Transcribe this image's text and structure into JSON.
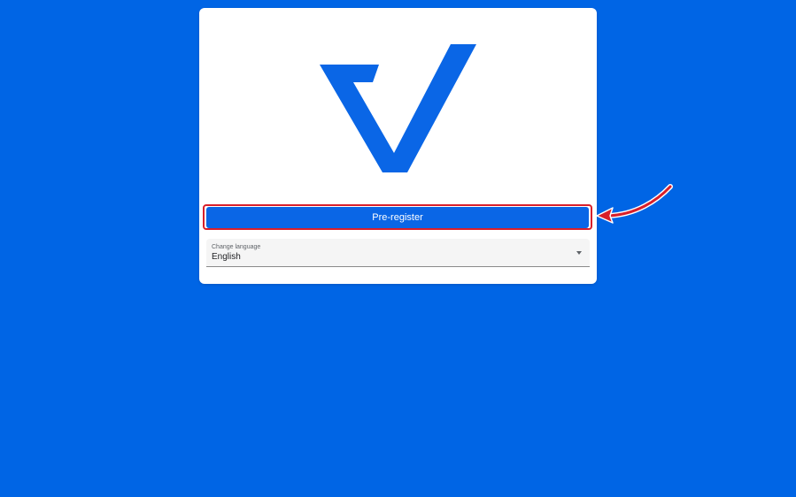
{
  "colors": {
    "background": "#0065e5",
    "card": "#ffffff",
    "accent": "#0a66e6",
    "highlight": "#d91f2a"
  },
  "logo": {
    "icon": "checkmark-v-logo-icon"
  },
  "pre_register": {
    "label": "Pre-register"
  },
  "language": {
    "label": "Change language",
    "value": "English",
    "icon": "chevron-down-icon"
  },
  "annotation": {
    "icon": "red-arrow-icon"
  }
}
